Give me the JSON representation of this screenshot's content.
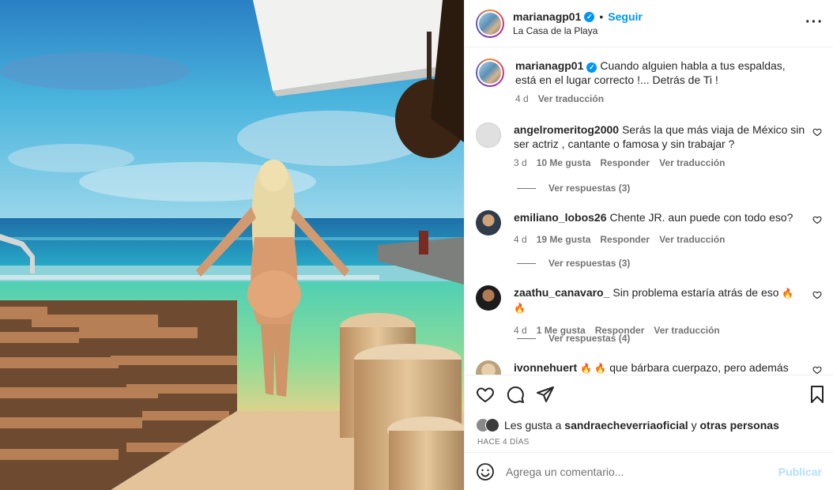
{
  "post": {
    "username": "marianagp01",
    "verified_badge": "✓",
    "follow_label": "Seguir",
    "separator": "•",
    "location": "La Casa de la Playa",
    "more_label": "···",
    "caption": {
      "username": "marianagp01",
      "text": "Cuando alguien habla a tus espaldas, está en el lugar correcto !... Detrás de Ti !",
      "age": "4 d",
      "translate": "Ver traducción"
    }
  },
  "comments": [
    {
      "username": "angelromeritog2000",
      "text": "Serás la que más viaja de México sin ser actriz , cantante o famosa y sin trabajar ?",
      "age": "3 d",
      "likes": "10 Me gusta",
      "reply": "Responder",
      "translate": "Ver traducción",
      "replies": "Ver respuestas (3)",
      "avatar_color": "#c7c7c7"
    },
    {
      "username": "emiliano_lobos26",
      "text": "Chente JR. aun puede con todo eso?",
      "age": "4 d",
      "likes": "19 Me gusta",
      "reply": "Responder",
      "translate": "Ver traducción",
      "replies": "Ver respuestas (3)",
      "avatar_color": "#5a6b7c"
    },
    {
      "username": "zaathu_canavaro_",
      "text": "Sin problema estaría atrás de eso",
      "emoji": "🔥 🔥",
      "age": "4 d",
      "likes": "1 Me gusta",
      "reply": "Responder",
      "translate": "Ver traducción",
      "replies": "Ver respuestas (4)",
      "avatar_color": "#2b2b2b"
    },
    {
      "username": "ivonnehuert",
      "emoji": "🔥 🔥",
      "text": "que bárbara cuerpazo, pero además eres",
      "avatar_color": "#b9a27d"
    }
  ],
  "likes": {
    "prefix": "Les gusta a",
    "user": "sandraecheverriaoficial",
    "conj": "y",
    "others": "otras personas"
  },
  "time_ago": "HACE 4 DÍAS",
  "add_comment": {
    "placeholder": "Agrega un comentario...",
    "publish": "Publicar"
  },
  "colors": {
    "accent": "#0095f6",
    "muted": "#737373",
    "publish_disabled": "#b2dffc"
  },
  "icons": [
    "heart-icon",
    "comment-icon",
    "share-icon",
    "bookmark-icon",
    "emoji-icon",
    "more-icon",
    "verified-icon"
  ]
}
